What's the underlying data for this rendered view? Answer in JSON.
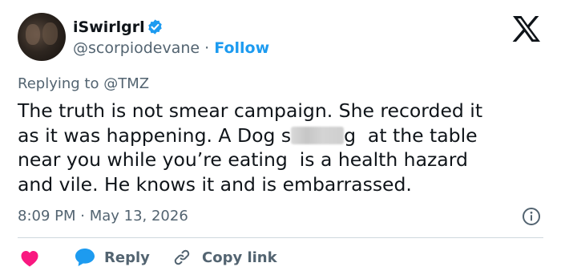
{
  "user": {
    "display_name": "iSwirlgrl",
    "handle_row": "@scorpiodevane · ",
    "follow_label": "Follow"
  },
  "tweet": {
    "replying_to": "Replying to @TMZ",
    "lines": [
      "The truth is not smear campaign. She recorded it",
      "as it was happening. A Dog s",
      "g  at the table",
      "near you while you’re eating  is a health hazard",
      "and vile. He knows it and is embarrassed."
    ],
    "timestamp": "8:09 PM · May 13, 2026"
  },
  "actions": {
    "reply_label": "Reply",
    "copy_link_label": "Copy link"
  },
  "colors": {
    "brand_blue": "#1d9bf0",
    "heart_pink": "#f91880",
    "secondary_text": "#536471",
    "primary_text": "#0f1419"
  },
  "icons": [
    "verified-badge-icon",
    "x-logo-icon",
    "info-icon",
    "heart-icon",
    "reply-bubble-icon",
    "link-icon"
  ]
}
